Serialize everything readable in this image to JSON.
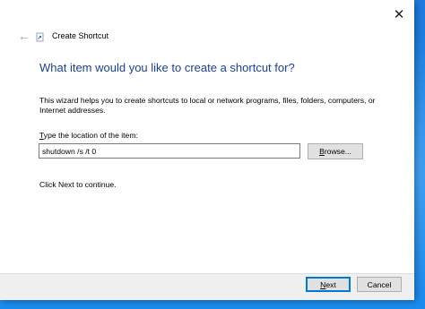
{
  "window": {
    "title": "Create Shortcut",
    "close_glyph": "✕",
    "back_glyph": "←"
  },
  "main": {
    "heading": "What item would you like to create a shortcut for?",
    "intro": "This wizard helps you to create shortcuts to local or network programs, files, folders, computers, or Internet addresses.",
    "field_label_first": "T",
    "field_label_rest": "ype the location of the item:",
    "location_value": "shutdown /s /t 0",
    "browse_first": "B",
    "browse_rest": "rowse...",
    "continue_text": "Click Next to continue."
  },
  "footer": {
    "next_first": "N",
    "next_rest": "ext",
    "cancel_label": "Cancel"
  },
  "colors": {
    "heading": "#1b3f9a",
    "desktop": "#1e84e6",
    "default_button_border": "#0078d7"
  },
  "icons": [
    "close-icon",
    "back-arrow-icon",
    "shortcut-wizard-icon"
  ]
}
